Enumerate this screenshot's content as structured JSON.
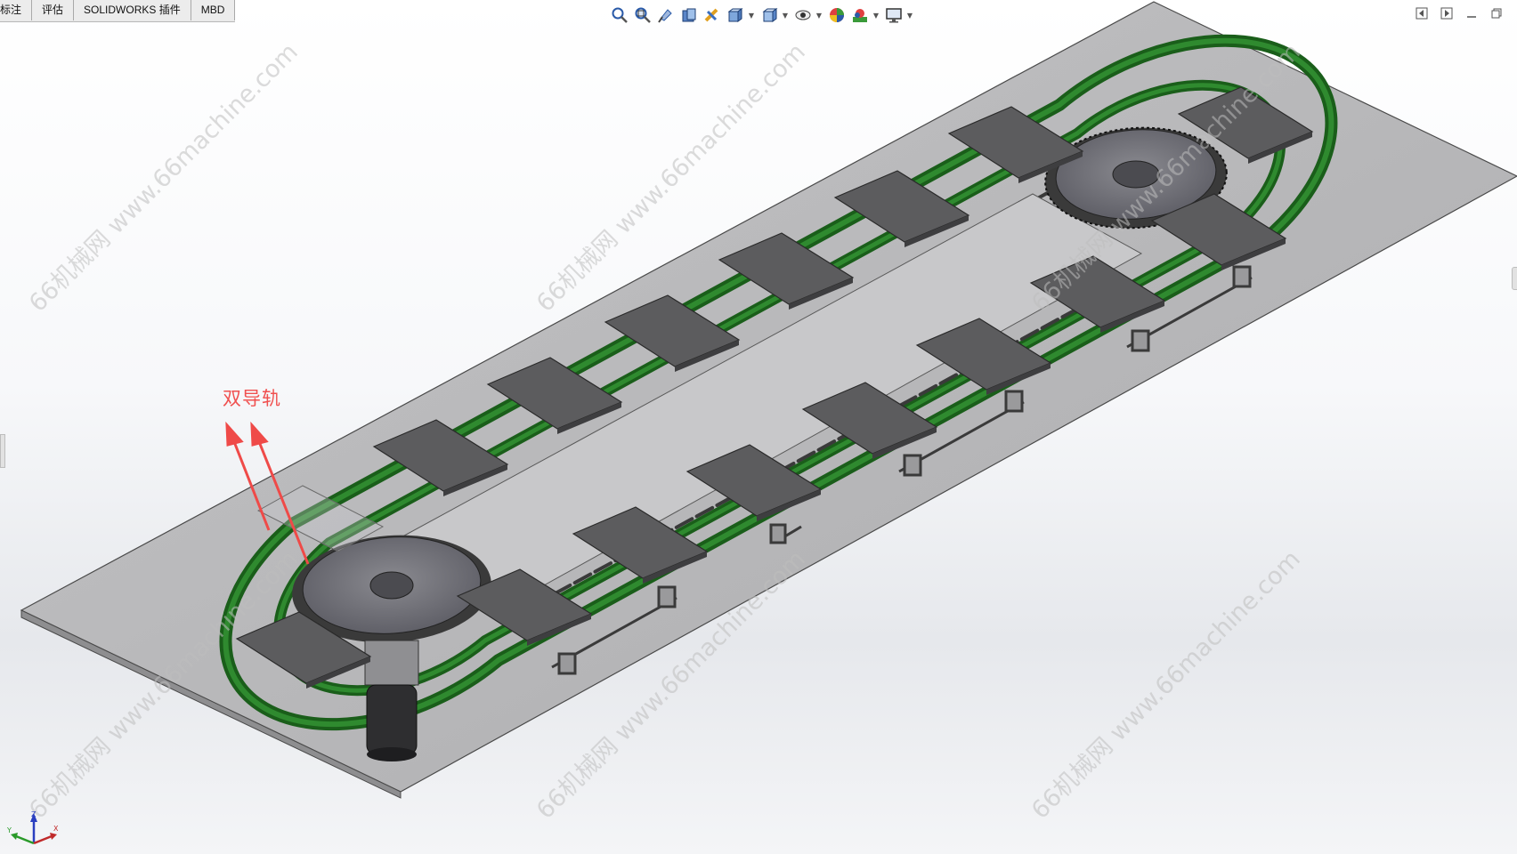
{
  "command_manager": {
    "tabs": [
      {
        "label": "标注"
      },
      {
        "label": "评估"
      },
      {
        "label": "SOLIDWORKS 插件"
      },
      {
        "label": "MBD"
      }
    ]
  },
  "view_toolbar": {
    "items": [
      {
        "icon": "zoom-to-fit-icon"
      },
      {
        "icon": "zoom-to-area-icon"
      },
      {
        "icon": "previous-view-icon"
      },
      {
        "icon": "section-view-icon"
      },
      {
        "icon": "dynamic-annotation-views-icon"
      },
      {
        "icon": "view-orientation-icon"
      },
      {
        "icon": "display-style-icon"
      },
      {
        "icon": "hide-show-items-icon"
      },
      {
        "icon": "edit-appearance-icon"
      },
      {
        "icon": "apply-scene-icon"
      },
      {
        "icon": "view-settings-icon"
      }
    ]
  },
  "window_controls": {
    "items": [
      {
        "icon": "tile-left-icon"
      },
      {
        "icon": "tile-right-icon"
      },
      {
        "icon": "minimize-icon"
      },
      {
        "icon": "restore-icon"
      }
    ]
  },
  "annotation": {
    "label": "双导轨",
    "arrow_color": "#ef4a48"
  },
  "watermark": {
    "text": "66机械网 www.66machine.com"
  },
  "triad": {
    "x_label": "X",
    "y_label": "Y",
    "z_label": "Z"
  },
  "colors": {
    "rail_green": "#1f6e1f",
    "plate_gray": "#5a5a5c",
    "base_plate": "#b9b9bb",
    "annotation_red": "#ef4a48"
  }
}
